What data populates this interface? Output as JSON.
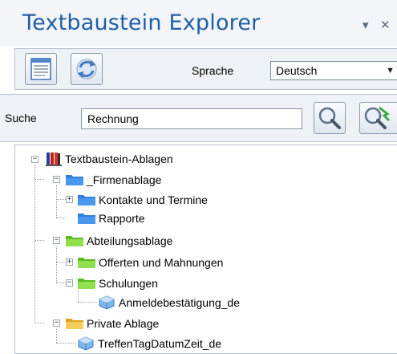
{
  "panel": {
    "title": "Textbaustein Explorer",
    "pin_glyph": "▾",
    "close_glyph": "✕"
  },
  "toolbar": {
    "language_label": "Sprache",
    "language_value": "Deutsch",
    "view_icon": "document-list-icon",
    "refresh_icon": "refresh-icon"
  },
  "search": {
    "label": "Suche",
    "value": "Rechnung",
    "search_icon": "magnifier-icon",
    "clear_icon": "magnifier-clear-icon"
  },
  "tree": {
    "root": "Textbaustein-Ablagen",
    "items": [
      {
        "label": "_Firmenablage",
        "icon": "blue-folder-icon"
      },
      {
        "label": "Kontakte und Termine",
        "icon": "blue-folder-icon"
      },
      {
        "label": "Rapporte",
        "icon": "blue-folder-icon"
      },
      {
        "label": "Abteilungsablage",
        "icon": "green-folder-icon"
      },
      {
        "label": "Offerten und Mahnungen",
        "icon": "green-folder-icon"
      },
      {
        "label": "Schulungen",
        "icon": "green-folder-icon"
      },
      {
        "label": "Anmeldebestätigung_de",
        "icon": "text-module-icon"
      },
      {
        "label": "Private Ablage",
        "icon": "yellow-folder-icon"
      },
      {
        "label": "TreffenTagDatumZeit_de",
        "icon": "text-module-icon"
      }
    ]
  },
  "colors": {
    "title": "#1f5fa8",
    "blue_folder": "#2f7fe0",
    "green_folder": "#7cd63a",
    "yellow_folder": "#f2c24a"
  }
}
